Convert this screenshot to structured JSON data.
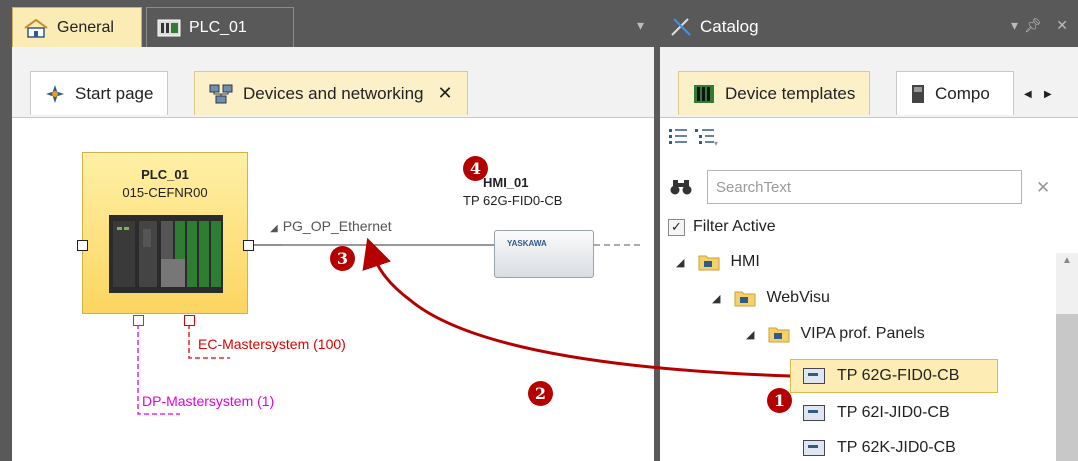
{
  "colors": {
    "accent_red": "#b40000",
    "highlight_yellow": "#fbecb6",
    "ec_red": "#e00000",
    "dp_magenta": "#e000e0"
  },
  "left_window": {
    "tabs": [
      {
        "label": "General",
        "icon": "home-icon",
        "active": true
      },
      {
        "label": "PLC_01",
        "icon": "plc-icon",
        "active": false
      }
    ],
    "page_tabs": [
      {
        "label": "Start page",
        "icon": "start-icon"
      },
      {
        "label": "Devices and networking",
        "icon": "network-icon",
        "close": "✕"
      }
    ]
  },
  "canvas": {
    "plc": {
      "name": "PLC_01",
      "type": "015-CEFNR00"
    },
    "network": {
      "label": "PG_OP_Ethernet",
      "collapse_glyph": "◢"
    },
    "hmi": {
      "name": "HMI_01",
      "type": "TP 62G-FID0-CB",
      "brand": "YASKAWA"
    },
    "ec_master": "EC-Mastersystem (100)",
    "dp_master": "DP-Mastersystem (1)"
  },
  "badges": {
    "one": "1",
    "two": "2",
    "three": "3",
    "four": "4"
  },
  "catalog": {
    "title": "Catalog",
    "tabs": [
      {
        "label": "Device templates",
        "icon": "device-templates-icon"
      },
      {
        "label": "Compo",
        "icon": "components-icon"
      }
    ],
    "search": {
      "placeholder": "SearchText"
    },
    "filter": {
      "label": "Filter Active",
      "checked": true
    },
    "tree": [
      {
        "label": "HMI",
        "level": 0
      },
      {
        "label": "WebVisu",
        "level": 1
      },
      {
        "label": "VIPA prof. Panels",
        "level": 2
      },
      {
        "label": "TP 62G-FID0-CB",
        "level": 3,
        "selected": true
      },
      {
        "label": "TP 62I-JID0-CB",
        "level": 3
      },
      {
        "label": "TP 62K-JID0-CB",
        "level": 3
      }
    ]
  }
}
